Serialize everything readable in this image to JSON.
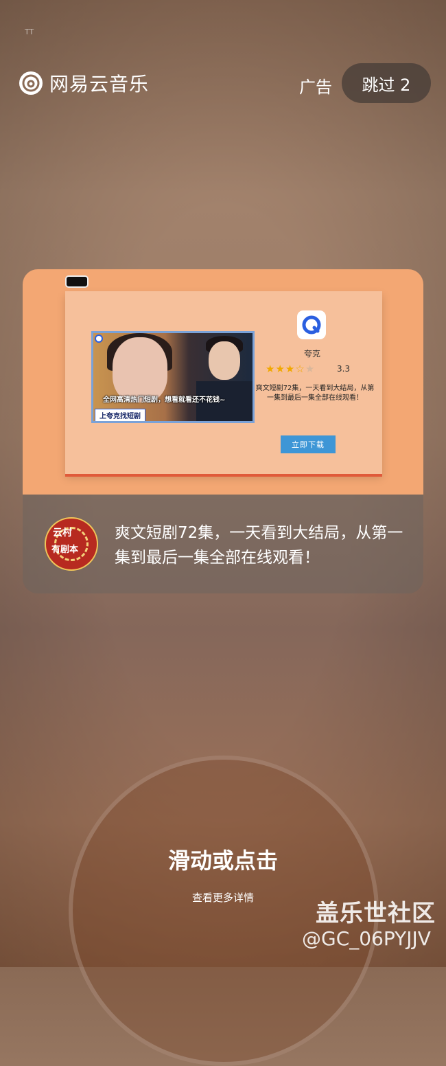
{
  "status": {
    "text": "TT"
  },
  "header": {
    "app_name": "网易云音乐",
    "ad_label": "广告",
    "skip_label": "跳过 2"
  },
  "ad_creative": {
    "app_name": "夸克",
    "rating": "3.3",
    "rating_value": 3.3,
    "rating_max": 5,
    "description": "爽文短剧72集，一天看到大结局，从第一集到最后一集全部在线观看！",
    "download_label": "立即下载",
    "video_subtitle": "全网高清热门短剧，想看就看还不花钱~",
    "video_tag": "上夸克找短剧"
  },
  "card": {
    "avatar_text_1": "云村",
    "avatar_text_2": "有剧本",
    "text": "爽文短剧72集，一天看到大结局，从第一集到最后一集全部在线观看！"
  },
  "cta": {
    "main": "滑动或点击",
    "sub": "查看更多详情"
  },
  "watermark": {
    "line1": "盖乐世社区",
    "line2": "@GC_06PYJJV"
  },
  "colors": {
    "card_top": "#f3a773",
    "download_button": "#3e96d6",
    "star": "#f1a800"
  }
}
